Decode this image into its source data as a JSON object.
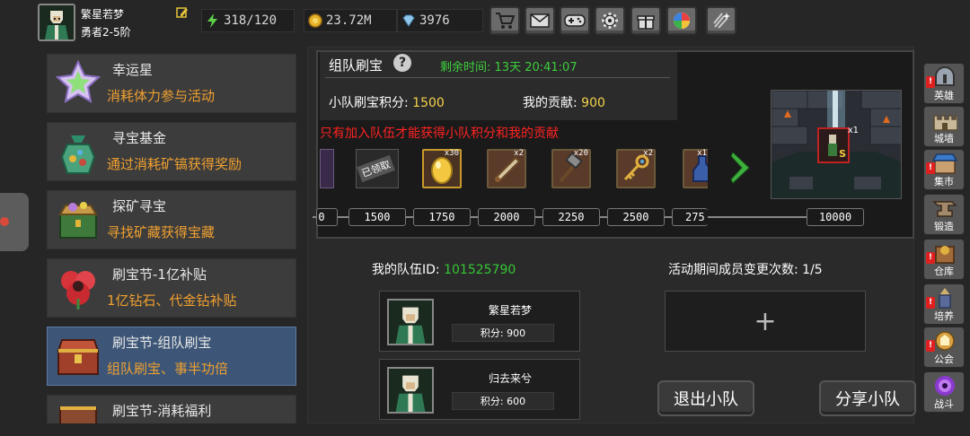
{
  "player": {
    "name": "繁星若梦",
    "rank": "勇者2-5阶"
  },
  "stats": {
    "stamina": "318/120",
    "gold": "23.72M",
    "diamonds": "3976"
  },
  "toolbar": [
    "shop-icon",
    "mail-icon",
    "gamepad-icon",
    "gear-icon",
    "gift-icon",
    "spinner-icon",
    "sparkle-icon"
  ],
  "sidebar": {
    "items": [
      {
        "title": "幸运星",
        "desc": "消耗体力参与活动",
        "icon": "star-icon"
      },
      {
        "title": "寻宝基金",
        "desc": "通过消耗矿镐获得奖励",
        "icon": "treasure-bag-icon"
      },
      {
        "title": "探矿寻宝",
        "desc": "寻找矿藏获得宝藏",
        "icon": "treasure-chest-icon"
      },
      {
        "title": "刷宝节-1亿补贴",
        "desc": "1亿钻石、代金钻补贴",
        "icon": "red-flower-icon"
      },
      {
        "title": "刷宝节-组队刷宝",
        "desc": "组队刷宝、事半功倍",
        "icon": "chest-icon"
      },
      {
        "title": "刷宝节-消耗福利",
        "desc": "",
        "icon": "chest-icon"
      }
    ]
  },
  "event": {
    "title": "组队刷宝",
    "time_label": "剩余时间:",
    "time_value": "13天 20:41:07",
    "score_label": "小队刷宝积分:",
    "score_value": "1500",
    "contrib_label": "我的贡献:",
    "contrib_value": "900",
    "warning": "只有加入队伍才能获得小队积分和我的贡献",
    "claimed_label": "已领取",
    "rewards": [
      {
        "icon": "egg-icon",
        "count": "x30"
      },
      {
        "icon": "scroll-icon",
        "count": "x2"
      },
      {
        "icon": "hammer-icon",
        "count": "x20"
      },
      {
        "icon": "key-icon",
        "count": "x2"
      },
      {
        "icon": "potion-icon",
        "count": "x1"
      }
    ],
    "milestones": [
      "1500",
      "1750",
      "2000",
      "2250",
      "2500",
      "275",
      "10000"
    ],
    "scene_item_count": "x1",
    "scene_item_label": "S"
  },
  "team": {
    "id_label": "我的队伍ID:",
    "id_value": "101525790",
    "changes_label": "活动期间成员变更次数:",
    "changes_value": "1/5",
    "members": [
      {
        "name": "繁星若梦",
        "score": "积分: 900"
      },
      {
        "name": "归去来兮",
        "score": "积分: 600"
      }
    ],
    "add_symbol": "+"
  },
  "buttons": {
    "leave": "退出小队",
    "share": "分享小队"
  },
  "rightmenu": [
    {
      "label": "英雄",
      "icon": "helmet-icon",
      "alert": true
    },
    {
      "label": "城墙",
      "icon": "castle-icon",
      "alert": false
    },
    {
      "label": "集市",
      "icon": "market-icon",
      "alert": true
    },
    {
      "label": "锻造",
      "icon": "anvil-icon",
      "alert": false
    },
    {
      "label": "仓库",
      "icon": "warehouse-icon",
      "alert": true
    },
    {
      "label": "培养",
      "icon": "cultivate-icon",
      "alert": true
    },
    {
      "label": "公会",
      "icon": "guild-icon",
      "alert": true
    },
    {
      "label": "战斗",
      "icon": "portal-icon",
      "alert": false
    }
  ],
  "colors": {
    "accent_orange": "#f0a030",
    "green": "#35c735",
    "warning_red": "#ff2222",
    "selected_blue": "#3d5677"
  }
}
